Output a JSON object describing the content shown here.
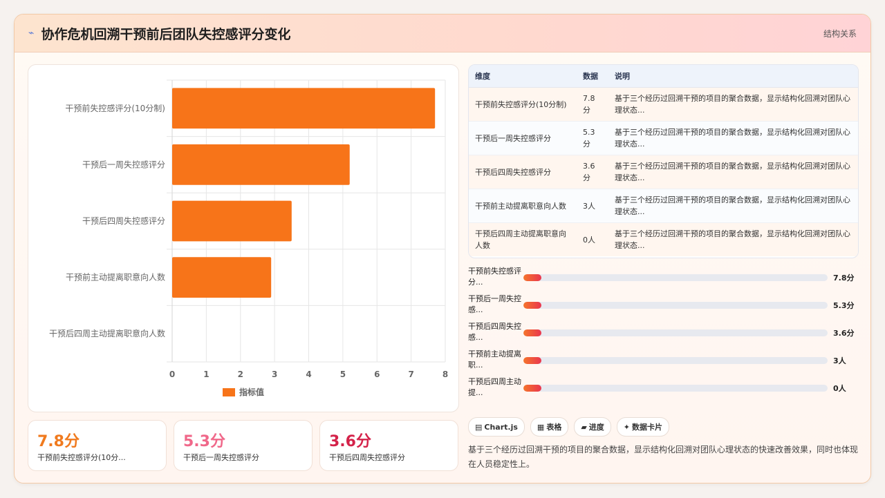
{
  "header": {
    "title": "协作危机回溯干预前后团队失控感评分变化",
    "right_label": "结构关系"
  },
  "chart_data": {
    "type": "bar",
    "orientation": "horizontal",
    "categories": [
      "干预前失控感评分(10分制)",
      "干预后一周失控感评分",
      "干预后四周失控感评分",
      "干预前主动提离职意向人数",
      "干预后四周主动提离职意向人数"
    ],
    "series": [
      {
        "name": "指标值",
        "values": [
          7.7,
          5.2,
          3.5,
          2.9,
          0
        ],
        "color": "#f77419"
      }
    ],
    "xticks": [
      "0",
      "1",
      "2",
      "3",
      "4",
      "5",
      "6",
      "7",
      "8"
    ],
    "xlim": [
      0,
      8
    ],
    "grid": true,
    "legend": "bottom"
  },
  "kpis": [
    {
      "value": "7.8分",
      "label": "干预前失控感评分(10分...",
      "color": "#f07a1e"
    },
    {
      "value": "5.3分",
      "label": "干预后一周失控感评分",
      "color": "#f0688a"
    },
    {
      "value": "3.6分",
      "label": "干预后四周失控感评分",
      "color": "#d4234a"
    }
  ],
  "table": {
    "headers": [
      "维度",
      "数据",
      "说明"
    ],
    "rows": [
      {
        "dim": "干预前失控感评分(10分制)",
        "val": "7.8分",
        "note": "基于三个经历过回溯干预的项目的聚合数据，显示结构化回溯对团队心理状态..."
      },
      {
        "dim": "干预后一周失控感评分",
        "val": "5.3分",
        "note": "基于三个经历过回溯干预的项目的聚合数据，显示结构化回溯对团队心理状态..."
      },
      {
        "dim": "干预后四周失控感评分",
        "val": "3.6分",
        "note": "基于三个经历过回溯干预的项目的聚合数据，显示结构化回溯对团队心理状态..."
      },
      {
        "dim": "干预前主动提离职意向人数",
        "val": "3人",
        "note": "基于三个经历过回溯干预的项目的聚合数据，显示结构化回溯对团队心理状态..."
      },
      {
        "dim": "干预后四周主动提离职意向人数",
        "val": "0人",
        "note": "基于三个经历过回溯干预的项目的聚合数据，显示结构化回溯对团队心理状态..."
      }
    ]
  },
  "progress": [
    {
      "label": "干预前失控感评分...",
      "value": "7.8分",
      "fill": 0.06
    },
    {
      "label": "干预后一周失控感...",
      "value": "5.3分",
      "fill": 0.06
    },
    {
      "label": "干预后四周失控感...",
      "value": "3.6分",
      "fill": 0.06
    },
    {
      "label": "干预前主动提离职...",
      "value": "3人",
      "fill": 0.06
    },
    {
      "label": "干预后四周主动提...",
      "value": "0人",
      "fill": 0.06
    }
  ],
  "tags": [
    {
      "icon": "▤",
      "icon_name": "chart-icon",
      "label": "Chart.js"
    },
    {
      "icon": "▦",
      "icon_name": "table-icon",
      "label": "表格"
    },
    {
      "icon": "▰",
      "icon_name": "progress-icon",
      "label": "进度"
    },
    {
      "icon": "✦",
      "icon_name": "card-icon",
      "label": "数据卡片"
    }
  ],
  "description": "基于三个经历过回溯干预的项目的聚合数据，显示结构化回溯对团队心理状态的快速改善效果，同时也体现在人员稳定性上。"
}
